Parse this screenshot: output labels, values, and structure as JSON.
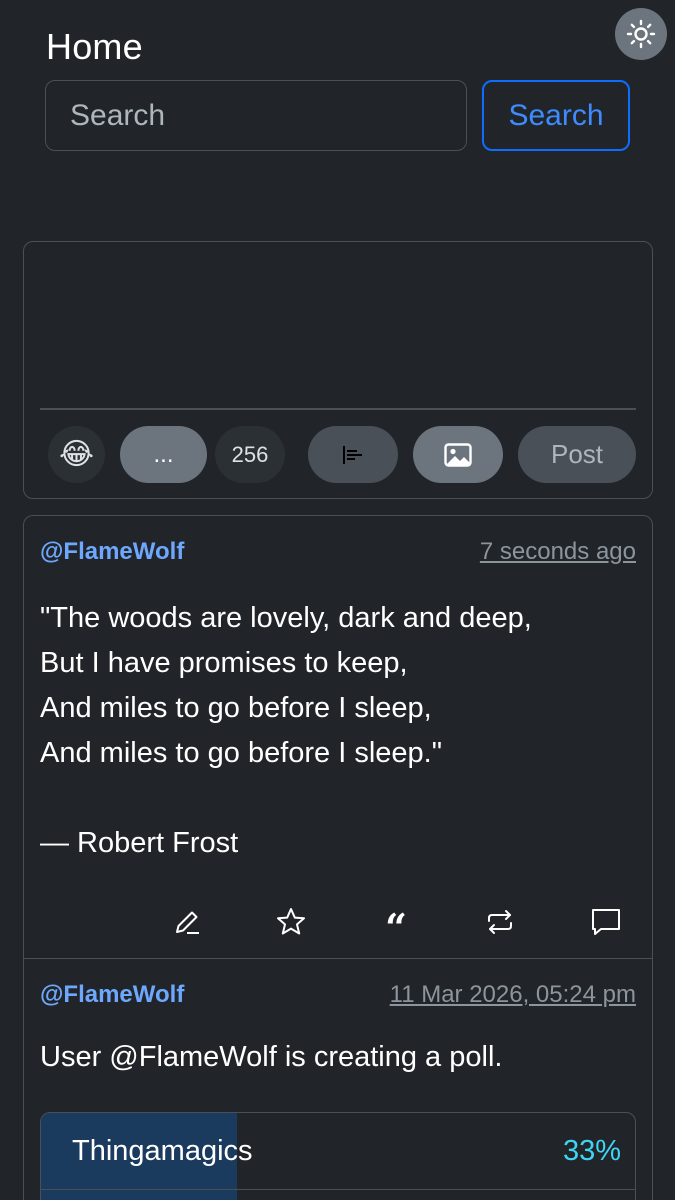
{
  "header": {
    "title": "Home",
    "theme_toggle_icon": "sun-icon"
  },
  "search": {
    "placeholder": "Search",
    "value": "",
    "button_label": "Search"
  },
  "composer": {
    "text": "",
    "emoji_icon": "😂",
    "more_label": "...",
    "char_count": "256",
    "poll_icon": "poll-icon",
    "image_icon": "image-icon",
    "post_label": "Post"
  },
  "posts": [
    {
      "author": "@FlameWolf",
      "time": "7 seconds ago",
      "lines": [
        "\"The woods are lovely, dark and deep,",
        "But I have promises to keep,",
        "And miles to go before I sleep,",
        "And miles to go before I sleep.\"",
        "",
        "— Robert Frost"
      ],
      "actions": [
        "edit-icon",
        "star-icon",
        "quote-icon",
        "repost-icon",
        "reply-icon"
      ]
    },
    {
      "author": "@FlameWolf",
      "time": "11 Mar 2026, 05:24 pm",
      "text": "User @FlameWolf is creating a poll.",
      "poll": {
        "options": [
          {
            "label": "Thingamagics",
            "percent_label": "33%",
            "share": 0.33
          }
        ]
      }
    }
  ],
  "colors": {
    "background": "#212529",
    "accent": "#0d6efd",
    "author": "#6ea8fe",
    "poll_percent": "#3dd5f3"
  }
}
